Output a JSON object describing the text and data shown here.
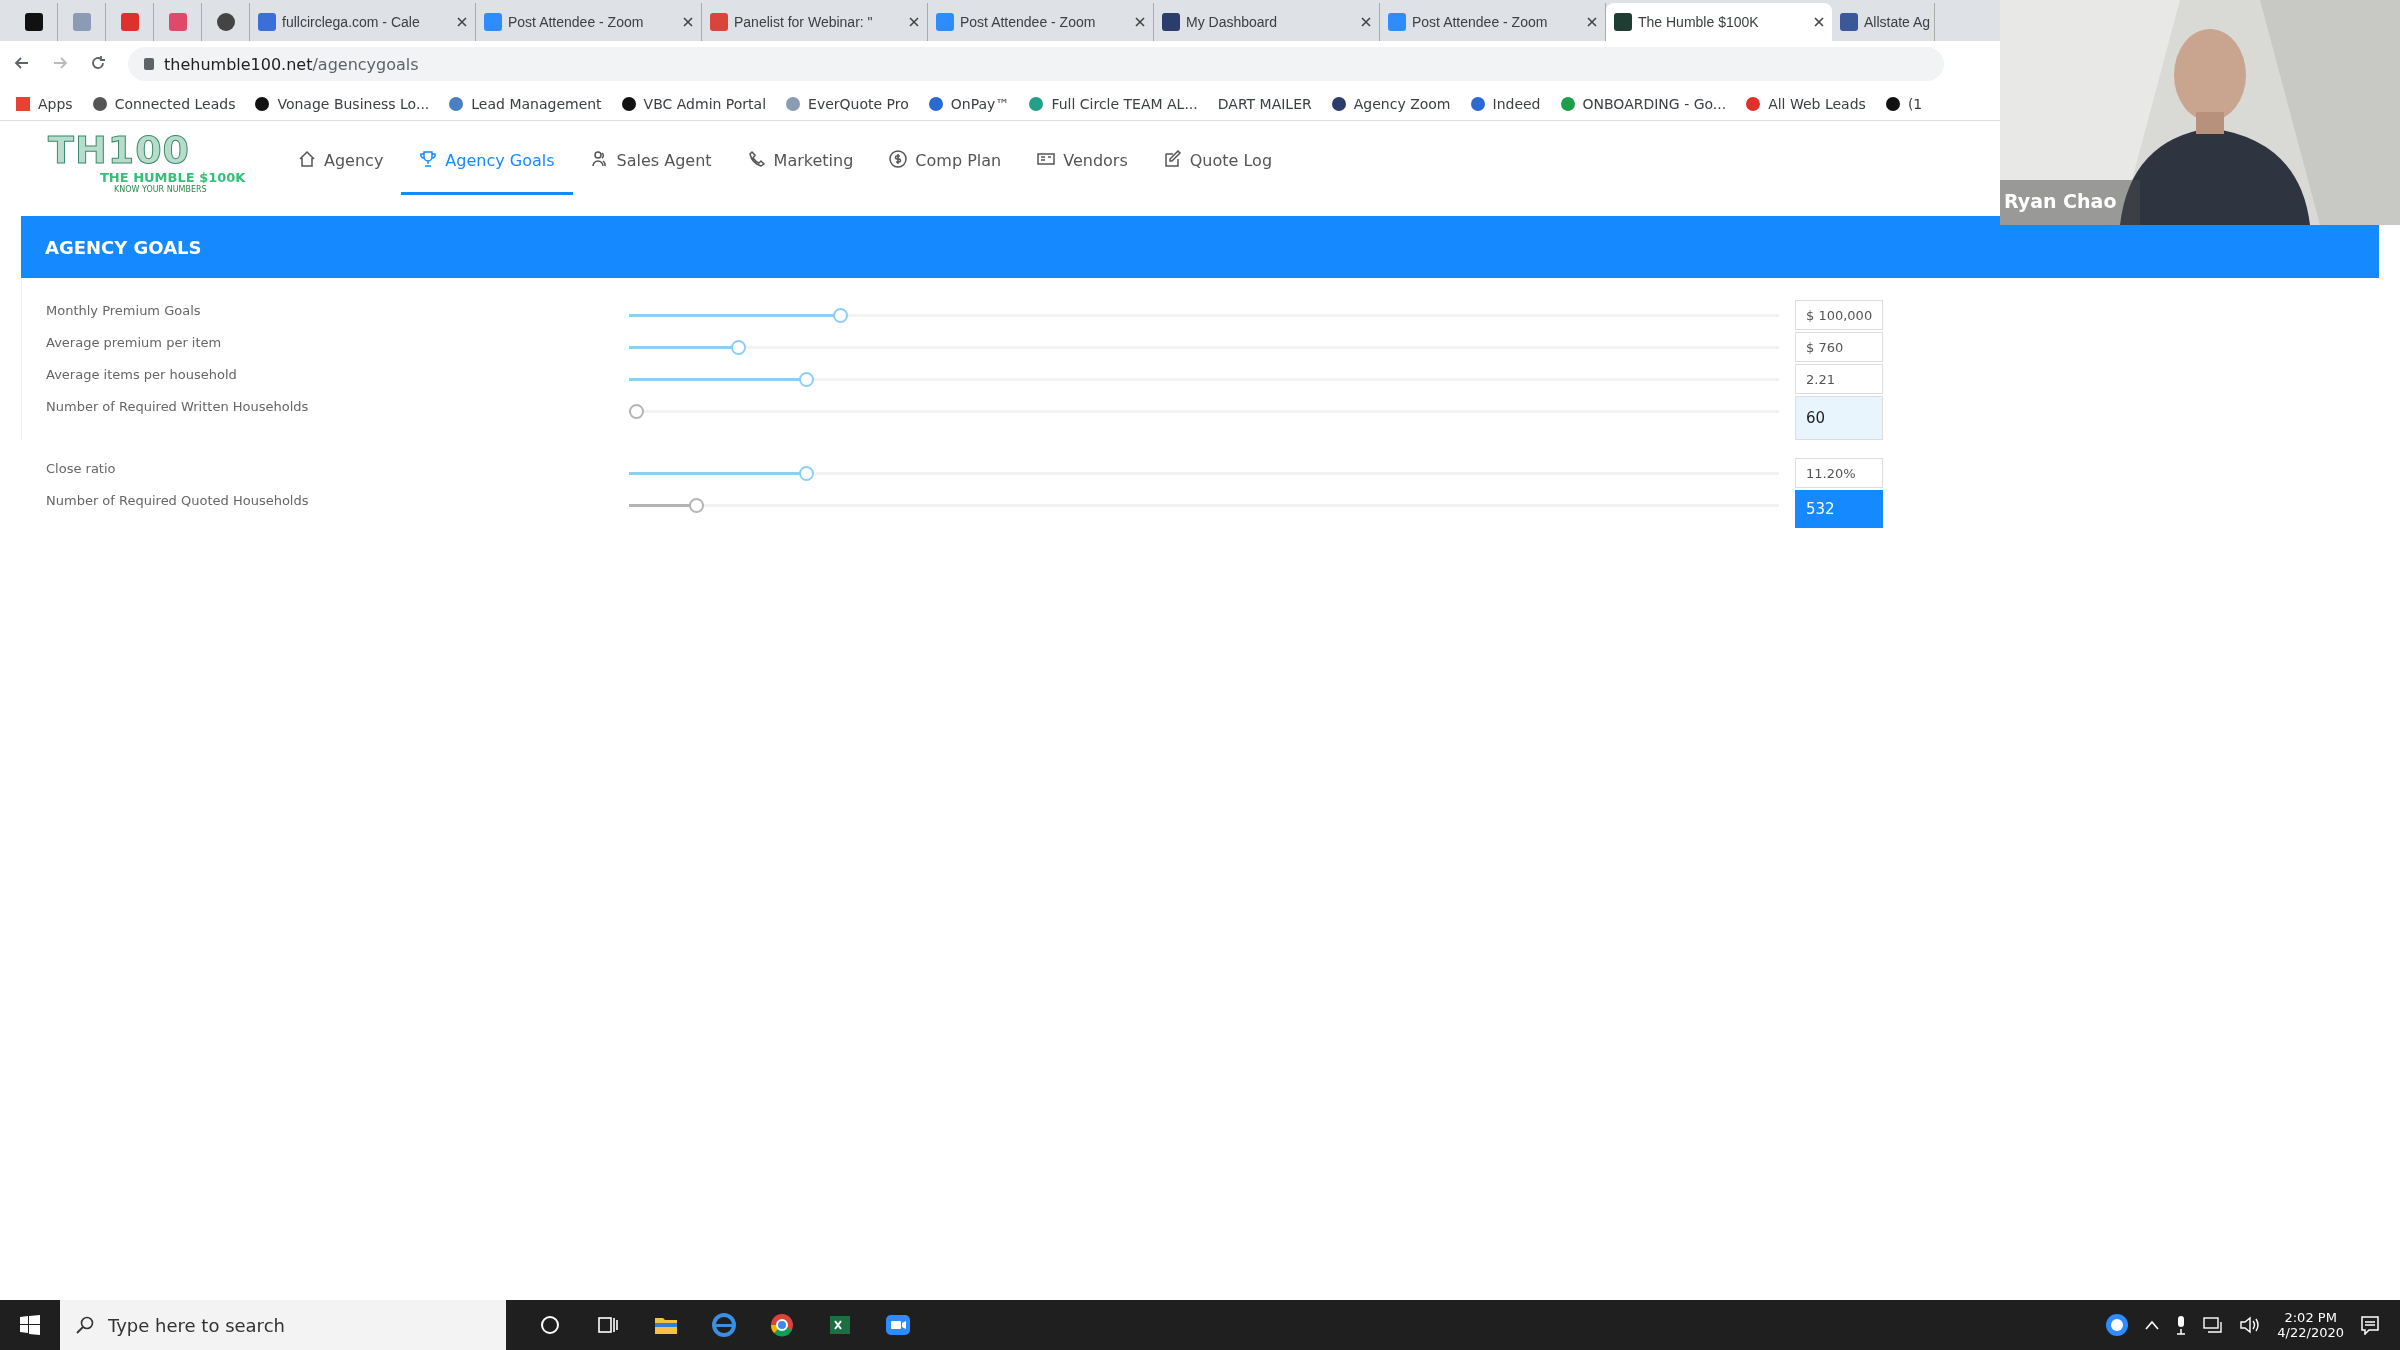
{
  "browser": {
    "tabs": [
      {
        "selected": false
      },
      {
        "selected": false
      },
      {
        "selected": false
      },
      {
        "selected": false
      },
      {
        "selected": false
      },
      {
        "title": "fullcirclega.com - Cale",
        "selected": false
      },
      {
        "title": "Post Attendee - Zoom",
        "selected": false
      },
      {
        "title": "Panelist for Webinar: \"",
        "selected": false
      },
      {
        "title": "Post Attendee - Zoom",
        "selected": false
      },
      {
        "title": "My Dashboard",
        "selected": false
      },
      {
        "title": "Post Attendee - Zoom",
        "selected": false
      },
      {
        "title": "The Humble $100K",
        "selected": true
      },
      {
        "title": "Allstate Ag",
        "selected": false
      }
    ],
    "url": {
      "host": "thehumble100.net",
      "path": "/agencygoals"
    },
    "bookmarks": [
      "Apps",
      "Connected Leads",
      "Vonage Business Lo...",
      "Lead Management",
      "VBC Admin Portal",
      "EverQuote Pro",
      "OnPay™",
      "Full Circle TEAM AL...",
      "DART MAILER",
      "Agency Zoom",
      "Indeed",
      "ONBOARDING - Go...",
      "All Web Leads",
      "(1"
    ]
  },
  "logo": {
    "mark": "TH100",
    "name": "THE HUMBLE $100K",
    "tagline": "KNOW YOUR NUMBERS"
  },
  "nav": [
    {
      "label": "Agency",
      "selected": false
    },
    {
      "label": "Agency Goals",
      "selected": true
    },
    {
      "label": "Sales Agent",
      "selected": false
    },
    {
      "label": "Marketing",
      "selected": false
    },
    {
      "label": "Comp Plan",
      "selected": false
    },
    {
      "label": "Vendors",
      "selected": false
    },
    {
      "label": "Quote Log",
      "selected": false
    }
  ],
  "panel": {
    "title": "AGENCY GOALS",
    "groups": [
      [
        {
          "label": "Monthly Premium Goals",
          "level": 0.18,
          "disabled": false,
          "value": "$ 100,000",
          "kind": "plain"
        },
        {
          "label": "Average premium per item",
          "level": 0.09,
          "disabled": false,
          "value": "$ 760",
          "kind": "plain"
        },
        {
          "label": "Average items per household",
          "level": 0.15,
          "disabled": false,
          "value": "2.21",
          "kind": "plain"
        },
        {
          "label": "Number of Required Written Households",
          "level": 0,
          "disabled": true,
          "value": "60",
          "kind": "result"
        }
      ],
      [
        {
          "label": "Close ratio",
          "level": 0.15,
          "disabled": false,
          "value": "11.20%",
          "kind": "plain"
        },
        {
          "label": "Number of Required Quoted Households",
          "level": 0.053,
          "disabled": true,
          "value": "532",
          "kind": "selected"
        }
      ]
    ]
  },
  "video": {
    "name": "Ryan Chao"
  },
  "taskbar": {
    "search": {
      "placeholder": "Type here to search"
    },
    "time": "2:02 PM",
    "date": "4/22/2020"
  }
}
